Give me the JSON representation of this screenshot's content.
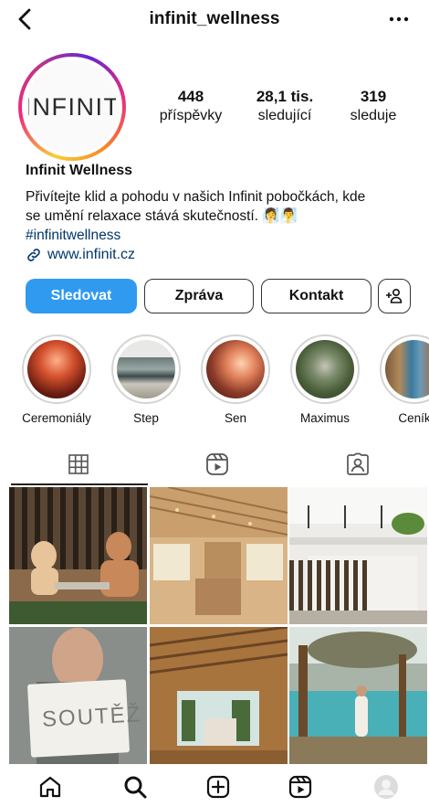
{
  "header": {
    "username": "infinit_wellness"
  },
  "profile": {
    "avatar_logo_text": "INFINIT",
    "stats": [
      {
        "value": "448",
        "label": "příspěvky"
      },
      {
        "value": "28,1 tis.",
        "label": "sledující"
      },
      {
        "value": "319",
        "label": "sleduje"
      }
    ],
    "name": "Infinit Wellness",
    "bio_line1": "Přivítejte klid a pohodu v našich Infinit pobočkách, kde",
    "bio_line2": "se umění relaxace stává skutečností.",
    "bio_emoji": "🧖‍♀️🧖‍♂️",
    "hashtag": "#infinitwellness",
    "link": "www.infinit.cz"
  },
  "buttons": {
    "follow": "Sledovat",
    "message": "Zpráva",
    "contact": "Kontakt"
  },
  "highlights": [
    {
      "label": "Ceremoniály"
    },
    {
      "label": "Step"
    },
    {
      "label": "Sen"
    },
    {
      "label": "Maximus"
    },
    {
      "label": "Ceník"
    }
  ],
  "tabs": {
    "active": "grid",
    "items": [
      "grid-icon",
      "reels-icon",
      "tagged-icon"
    ]
  },
  "grid_posts": [
    {
      "overlay_text": ""
    },
    {
      "overlay_text": ""
    },
    {
      "overlay_text": ""
    },
    {
      "overlay_text": "SOUTĚŽ"
    },
    {
      "overlay_text": ""
    },
    {
      "overlay_text": ""
    }
  ],
  "colors": {
    "follow_button": "#2f9af0",
    "link": "#00376b"
  }
}
